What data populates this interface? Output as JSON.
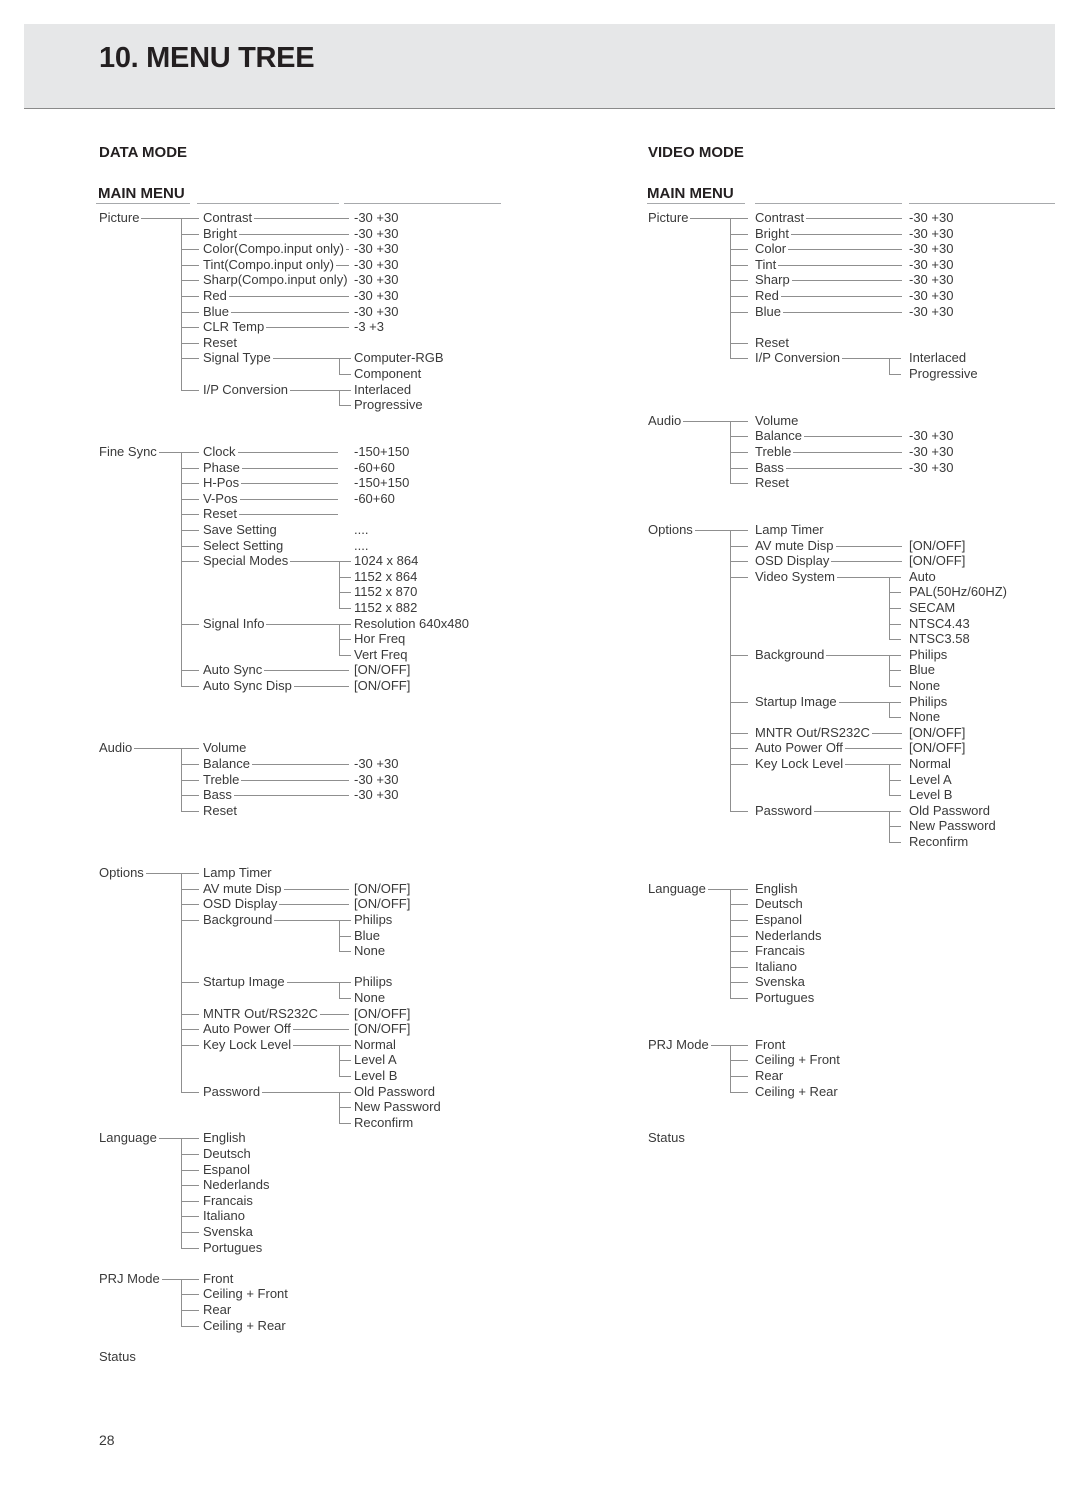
{
  "page": {
    "title": "10. MENU TREE",
    "page_number": "28"
  },
  "data_mode": {
    "mode_title": "DATA MODE",
    "menu_title": "MAIN MENU",
    "groups": [
      {
        "label": "Picture",
        "row": 0,
        "items": [
          {
            "label": "Contrast",
            "row": 0,
            "line": true,
            "values": [
              "-30 +30"
            ]
          },
          {
            "label": "Bright",
            "row": 1,
            "line": true,
            "values": [
              "-30 +30"
            ]
          },
          {
            "label": "Color(Compo.input only)",
            "row": 2,
            "line": true,
            "values": [
              "-30 +30"
            ]
          },
          {
            "label": "Tint(Compo.input only)",
            "row": 3,
            "line": true,
            "values": [
              "-30 +30"
            ]
          },
          {
            "label": "Sharp(Compo.input only)",
            "row": 4,
            "line": true,
            "values": [
              "-30 +30"
            ]
          },
          {
            "label": "Red",
            "row": 5,
            "line": true,
            "values": [
              "-30 +30"
            ]
          },
          {
            "label": "Blue",
            "row": 6,
            "line": true,
            "values": [
              "-30 +30"
            ]
          },
          {
            "label": "CLR Temp",
            "row": 7,
            "line": true,
            "values": [
              "-3 +3"
            ]
          },
          {
            "label": "Reset",
            "row": 8,
            "values": []
          },
          {
            "label": "Signal Type",
            "row": 9,
            "branch": true,
            "values": [
              "Computer-RGB",
              "Component"
            ]
          },
          {
            "label": "I/P Conversion",
            "row": 11,
            "branch": true,
            "values": [
              "Interlaced",
              "Progressive"
            ]
          }
        ]
      },
      {
        "label": "Fine Sync",
        "row": 15,
        "items": [
          {
            "label": "Clock",
            "row": 15,
            "line": true,
            "short": true,
            "values": [
              "-150+150"
            ]
          },
          {
            "label": "Phase",
            "row": 16,
            "line": true,
            "short": true,
            "values": [
              "-60+60"
            ]
          },
          {
            "label": "H-Pos",
            "row": 17,
            "line": true,
            "short": true,
            "values": [
              "-150+150"
            ]
          },
          {
            "label": "V-Pos",
            "row": 18,
            "line": true,
            "short": true,
            "values": [
              "-60+60"
            ]
          },
          {
            "label": "Reset",
            "row": 19,
            "line": true,
            "short": true,
            "values": []
          },
          {
            "label": "Save Setting",
            "row": 20,
            "values": [
              "...."
            ]
          },
          {
            "label": "Select Setting",
            "row": 21,
            "values": [
              "...."
            ]
          },
          {
            "label": "Special Modes",
            "row": 22,
            "branch": true,
            "values": [
              "1024 x 864",
              "1152 x 864",
              "1152 x 870",
              "1152 x 882"
            ]
          },
          {
            "label": "Signal Info",
            "row": 26,
            "branch": true,
            "values": [
              "Resolution 640x480",
              "Hor Freq",
              "Vert Freq"
            ]
          },
          {
            "label": "Auto Sync",
            "row": 29,
            "line": true,
            "values": [
              "[ON/OFF]"
            ]
          },
          {
            "label": "Auto Sync Disp",
            "row": 30,
            "line": true,
            "values": [
              "[ON/OFF]"
            ]
          }
        ]
      },
      {
        "label": "Audio",
        "row": 34,
        "items": [
          {
            "label": "Volume",
            "row": 34,
            "values": []
          },
          {
            "label": "Balance",
            "row": 35,
            "line": true,
            "values": [
              "-30 +30"
            ]
          },
          {
            "label": "Treble",
            "row": 36,
            "line": true,
            "values": [
              "-30 +30"
            ]
          },
          {
            "label": "Bass",
            "row": 37,
            "line": true,
            "values": [
              "-30 +30"
            ]
          },
          {
            "label": "Reset",
            "row": 38,
            "values": []
          }
        ]
      },
      {
        "label": "Options",
        "row": 42,
        "items": [
          {
            "label": "Lamp Timer",
            "row": 42,
            "values": []
          },
          {
            "label": "AV mute Disp",
            "row": 43,
            "line": true,
            "values": [
              "[ON/OFF]"
            ]
          },
          {
            "label": "OSD Display",
            "row": 44,
            "line": true,
            "values": [
              "[ON/OFF]"
            ]
          },
          {
            "label": "Background",
            "row": 45,
            "branch": true,
            "values": [
              "Philips",
              "Blue",
              "None"
            ]
          },
          {
            "label": "Startup Image",
            "row": 49,
            "branch": true,
            "values": [
              "Philips",
              "None"
            ]
          },
          {
            "label": "MNTR Out/RS232C",
            "row": 51,
            "line": true,
            "values": [
              "[ON/OFF]"
            ]
          },
          {
            "label": "Auto Power Off",
            "row": 52,
            "line": true,
            "values": [
              "[ON/OFF]"
            ]
          },
          {
            "label": "Key Lock Level",
            "row": 53,
            "branch": true,
            "values": [
              "Normal",
              "Level A",
              "Level B"
            ]
          },
          {
            "label": "Password",
            "row": 56,
            "branch": true,
            "values": [
              "Old Password",
              "New Password",
              "Reconfirm"
            ]
          }
        ]
      },
      {
        "label": "Language",
        "row": 59,
        "items": [
          {
            "label": "English",
            "row": 59,
            "values": []
          },
          {
            "label": "Deutsch",
            "row": 60,
            "values": []
          },
          {
            "label": "Espanol",
            "row": 61,
            "values": []
          },
          {
            "label": "Nederlands",
            "row": 62,
            "values": []
          },
          {
            "label": "Francais",
            "row": 63,
            "values": []
          },
          {
            "label": "Italiano",
            "row": 64,
            "values": []
          },
          {
            "label": "Svenska",
            "row": 65,
            "values": []
          },
          {
            "label": "Portugues",
            "row": 66,
            "values": []
          }
        ]
      },
      {
        "label": "PRJ Mode",
        "row": 68,
        "items": [
          {
            "label": "Front",
            "row": 68,
            "values": []
          },
          {
            "label": "Ceiling + Front",
            "row": 69,
            "values": []
          },
          {
            "label": "Rear",
            "row": 70,
            "values": []
          },
          {
            "label": "Ceiling + Rear",
            "row": 71,
            "values": []
          }
        ]
      },
      {
        "label": "Status",
        "row": 73,
        "items": []
      }
    ]
  },
  "video_mode": {
    "mode_title": "VIDEO MODE",
    "menu_title": "MAIN MENU",
    "groups": [
      {
        "label": "Picture",
        "row": 0,
        "items": [
          {
            "label": "Contrast",
            "row": 0,
            "line": true,
            "values": [
              "-30 +30"
            ]
          },
          {
            "label": "Bright",
            "row": 1,
            "line": true,
            "values": [
              "-30 +30"
            ]
          },
          {
            "label": "Color",
            "row": 2,
            "line": true,
            "values": [
              "-30 +30"
            ]
          },
          {
            "label": "Tint",
            "row": 3,
            "line": true,
            "values": [
              "-30 +30"
            ]
          },
          {
            "label": "Sharp",
            "row": 4,
            "line": true,
            "values": [
              "-30 +30"
            ]
          },
          {
            "label": "Red",
            "row": 5,
            "line": true,
            "values": [
              "-30 +30"
            ]
          },
          {
            "label": "Blue",
            "row": 6,
            "line": true,
            "values": [
              "-30 +30"
            ]
          },
          {
            "label": "Reset",
            "row": 8,
            "values": []
          },
          {
            "label": "I/P Conversion",
            "row": 9,
            "branch": true,
            "values": [
              "Interlaced",
              "Progressive"
            ]
          }
        ]
      },
      {
        "label": "Audio",
        "row": 13,
        "items": [
          {
            "label": "Volume",
            "row": 13,
            "values": []
          },
          {
            "label": "Balance",
            "row": 14,
            "line": true,
            "values": [
              "-30 +30"
            ]
          },
          {
            "label": "Treble",
            "row": 15,
            "line": true,
            "values": [
              "-30 +30"
            ]
          },
          {
            "label": "Bass",
            "row": 16,
            "line": true,
            "values": [
              "-30 +30"
            ]
          },
          {
            "label": "Reset",
            "row": 17,
            "values": []
          }
        ]
      },
      {
        "label": "Options",
        "row": 20,
        "items": [
          {
            "label": "Lamp Timer",
            "row": 20,
            "values": []
          },
          {
            "label": "AV mute Disp",
            "row": 21,
            "line": true,
            "values": [
              "[ON/OFF]"
            ]
          },
          {
            "label": "OSD Display",
            "row": 22,
            "line": true,
            "values": [
              "[ON/OFF]"
            ]
          },
          {
            "label": "Video System",
            "row": 23,
            "branch": true,
            "values": [
              "Auto",
              "PAL(50Hz/60HZ)",
              "SECAM",
              "NTSC4.43",
              "NTSC3.58"
            ]
          },
          {
            "label": "Background",
            "row": 28,
            "branch": true,
            "values": [
              "Philips",
              "Blue",
              "None"
            ]
          },
          {
            "label": "Startup Image",
            "row": 31,
            "branch": true,
            "values": [
              "Philips",
              "None"
            ]
          },
          {
            "label": "MNTR Out/RS232C",
            "row": 33,
            "line": true,
            "values": [
              "[ON/OFF]"
            ]
          },
          {
            "label": "Auto Power Off",
            "row": 34,
            "line": true,
            "values": [
              "[ON/OFF]"
            ]
          },
          {
            "label": "Key Lock Level",
            "row": 35,
            "branch": true,
            "values": [
              "Normal",
              "Level A",
              "Level B"
            ]
          },
          {
            "label": "Password",
            "row": 38,
            "branch": true,
            "values": [
              "Old Password",
              "New Password",
              "Reconfirm"
            ]
          }
        ]
      },
      {
        "label": "Language",
        "row": 43,
        "items": [
          {
            "label": "English",
            "row": 43,
            "values": []
          },
          {
            "label": "Deutsch",
            "row": 44,
            "values": []
          },
          {
            "label": "Espanol",
            "row": 45,
            "values": []
          },
          {
            "label": "Nederlands",
            "row": 46,
            "values": []
          },
          {
            "label": "Francais",
            "row": 47,
            "values": []
          },
          {
            "label": "Italiano",
            "row": 48,
            "values": []
          },
          {
            "label": "Svenska",
            "row": 49,
            "values": []
          },
          {
            "label": "Portugues",
            "row": 50,
            "values": []
          }
        ]
      },
      {
        "label": "PRJ Mode",
        "row": 53,
        "items": [
          {
            "label": "Front",
            "row": 53,
            "values": []
          },
          {
            "label": "Ceiling + Front",
            "row": 54,
            "values": []
          },
          {
            "label": "Rear",
            "row": 55,
            "values": []
          },
          {
            "label": "Ceiling + Rear",
            "row": 56,
            "values": []
          }
        ]
      },
      {
        "label": "Status",
        "row": 59,
        "items": []
      }
    ]
  }
}
